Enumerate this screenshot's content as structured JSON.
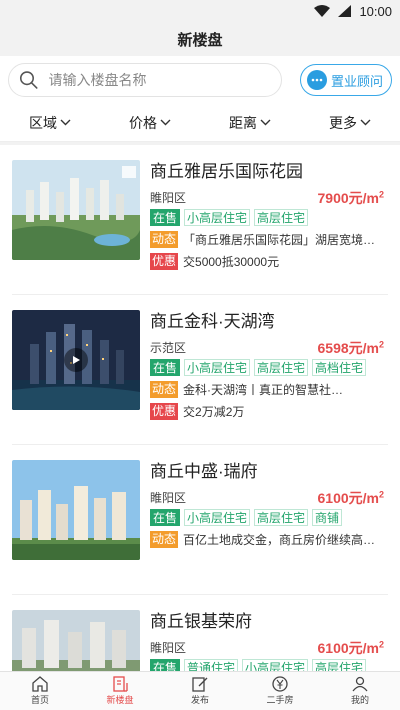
{
  "status": {
    "time": "10:00"
  },
  "header": {
    "title": "新楼盘"
  },
  "search": {
    "placeholder": "请输入楼盘名称"
  },
  "advisor": {
    "label": "置业顾问"
  },
  "filters": [
    {
      "label": "区域"
    },
    {
      "label": "价格"
    },
    {
      "label": "距离"
    },
    {
      "label": "更多"
    }
  ],
  "listings": [
    {
      "name": "商丘雅居乐国际花园",
      "district": "睢阳区",
      "price": "7900元/m",
      "price_sup": "2",
      "sale_tag": "在售",
      "tags": [
        "小高层住宅",
        "高层住宅"
      ],
      "news_badge": "动态",
      "news": "「商丘雅居乐国际花园」湖居宽境，…",
      "promo_badge": "优惠",
      "promo": "交5000抵30000元"
    },
    {
      "name": "商丘金科·天湖湾",
      "district": "示范区",
      "price": "6598元/m",
      "price_sup": "2",
      "sale_tag": "在售",
      "tags": [
        "小高层住宅",
        "高层住宅",
        "高档住宅"
      ],
      "news_badge": "动态",
      "news": "金科·天湖湾丨真正的智慧社…",
      "promo_badge": "优惠",
      "promo": "交2万减2万"
    },
    {
      "name": "商丘中盛·瑞府",
      "district": "睢阳区",
      "price": "6100元/m",
      "price_sup": "2",
      "sale_tag": "在售",
      "tags": [
        "小高层住宅",
        "高层住宅",
        "商铺"
      ],
      "news_badge": "动态",
      "news": "百亿土地成交金，商丘房价继续高歌…"
    },
    {
      "name": "商丘银基荣府",
      "district": "睢阳区",
      "price": "6100元/m",
      "price_sup": "2",
      "sale_tag": "在售",
      "tags": [
        "普通住宅",
        "小高层住宅",
        "高层住宅"
      ]
    }
  ],
  "tabbar": [
    {
      "label": "首页"
    },
    {
      "label": "新楼盘"
    },
    {
      "label": "发布"
    },
    {
      "label": "二手房"
    },
    {
      "label": "我的"
    }
  ],
  "colors": {
    "accent": "#e44c4c",
    "sale_green": "#23a56c",
    "news_orange": "#f39c2c",
    "advisor_blue": "#2a9de0"
  }
}
